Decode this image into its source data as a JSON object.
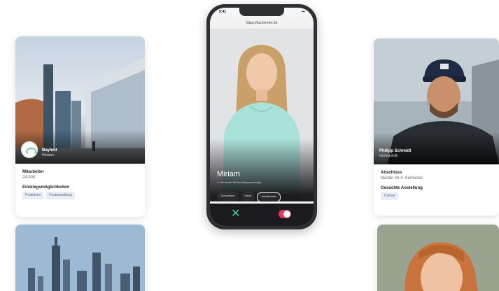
{
  "company_card": {
    "name": "Baylent",
    "location": "Hessen",
    "employees_label": "Mitarbeiter",
    "employees_value": "24.000",
    "entry_label": "Einstiegsmöglichkeiten",
    "tags": [
      "Praktikum",
      "Festanstellung"
    ]
  },
  "phone": {
    "time": "9:41",
    "status_icons": "▪▪▪",
    "url": "https://karrierehrt.de",
    "profile_name": "Miriam",
    "profile_sub": "4. Semester Wirtschaftspsychologie",
    "chips": [
      "Teamplayer",
      "Talent",
      "Ambitioniert"
    ],
    "reject_symbol": "✕"
  },
  "candidate_card": {
    "name": "Philipp Schmidt",
    "field": "Germanistik",
    "degree_label": "Abschluss",
    "degree_value": "Master im 4. Semester",
    "position_label": "Gesuchte Anstellung",
    "tags": [
      "Trainee"
    ]
  },
  "colors": {
    "accent_pink": "#e8335e",
    "accent_teal": "#3fd1a8",
    "tag_bg": "#e9eef6"
  }
}
